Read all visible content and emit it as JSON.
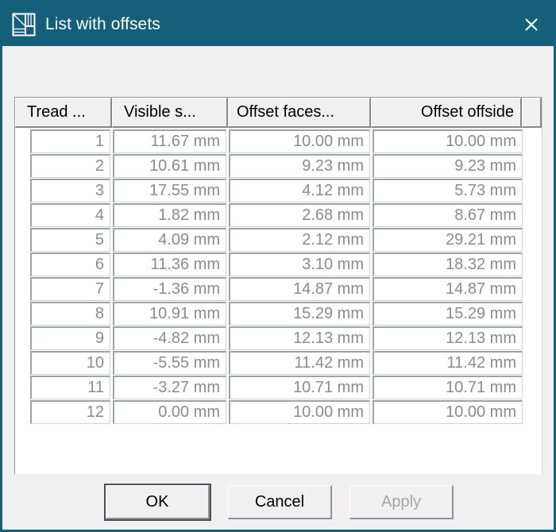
{
  "window": {
    "title": "List with offsets",
    "icon": "stair-tread-icon",
    "close_label": "✕",
    "titlebar_color": "#14607a"
  },
  "table": {
    "columns": [
      {
        "label": "Tread ...",
        "key": "tread"
      },
      {
        "label": "Visible s...",
        "key": "visible"
      },
      {
        "label": "Offset faces...",
        "key": "offset_faces"
      },
      {
        "label": "Offset offside",
        "key": "offset_offside"
      },
      {
        "label": "",
        "key": "spacer"
      }
    ],
    "rows": [
      {
        "tread": "1",
        "visible": "11.67 mm",
        "offset_faces": "10.00 mm",
        "offset_offside": "10.00 mm"
      },
      {
        "tread": "2",
        "visible": "10.61 mm",
        "offset_faces": "9.23 mm",
        "offset_offside": "9.23 mm"
      },
      {
        "tread": "3",
        "visible": "17.55 mm",
        "offset_faces": "4.12 mm",
        "offset_offside": "5.73 mm"
      },
      {
        "tread": "4",
        "visible": "1.82 mm",
        "offset_faces": "2.68 mm",
        "offset_offside": "8.67 mm"
      },
      {
        "tread": "5",
        "visible": "4.09 mm",
        "offset_faces": "2.12 mm",
        "offset_offside": "29.21 mm"
      },
      {
        "tread": "6",
        "visible": "11.36 mm",
        "offset_faces": "3.10 mm",
        "offset_offside": "18.32 mm"
      },
      {
        "tread": "7",
        "visible": "-1.36 mm",
        "offset_faces": "14.87 mm",
        "offset_offside": "14.87 mm"
      },
      {
        "tread": "8",
        "visible": "10.91 mm",
        "offset_faces": "15.29 mm",
        "offset_offside": "15.29 mm"
      },
      {
        "tread": "9",
        "visible": "-4.82 mm",
        "offset_faces": "12.13 mm",
        "offset_offside": "12.13 mm"
      },
      {
        "tread": "10",
        "visible": "-5.55 mm",
        "offset_faces": "11.42 mm",
        "offset_offside": "11.42 mm"
      },
      {
        "tread": "11",
        "visible": "-3.27 mm",
        "offset_faces": "10.71 mm",
        "offset_offside": "10.71 mm"
      },
      {
        "tread": "12",
        "visible": "0.00 mm",
        "offset_faces": "10.00 mm",
        "offset_offside": "10.00 mm"
      }
    ]
  },
  "footer": {
    "ok_label": "OK",
    "cancel_label": "Cancel",
    "apply_label": "Apply",
    "apply_enabled": false
  }
}
